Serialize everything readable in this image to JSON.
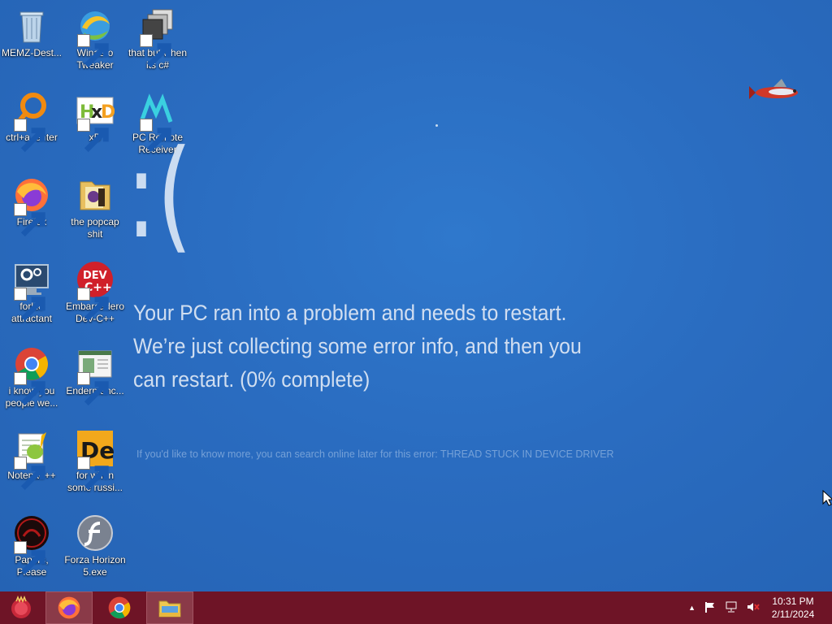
{
  "desktop_icons": [
    {
      "label": "MEMZ-Dest...",
      "icon": "recycle-bin-icon"
    },
    {
      "label": "Winaero Tweaker",
      "icon": "winaero-tweaker-icon"
    },
    {
      "label": "that but when its c#",
      "icon": "stacked-windows-icon"
    },
    {
      "label": "ctrl+a, enter",
      "icon": "orange-ring-icon"
    },
    {
      "label": "xD",
      "icon": "hxd-icon"
    },
    {
      "label": "PC Remote Receiver",
      "icon": "pc-remote-icon"
    },
    {
      "label": "Firefox",
      "icon": "firefox-icon"
    },
    {
      "label": "the popcap shit",
      "icon": "folder-icon"
    },
    {
      "label": "forkie attractant",
      "icon": "computer-settings-icon"
    },
    {
      "label": "Embarcadero Dev-C++",
      "icon": "devcpp-icon"
    },
    {
      "label": "i know you people we...",
      "icon": "chrome-icon"
    },
    {
      "label": "Endermanc...",
      "icon": "window-app-icon"
    },
    {
      "label": "Notepad++",
      "icon": "notepadpp-icon"
    },
    {
      "label": "for when some russi...",
      "icon": "de-icon"
    },
    {
      "label": "Papers, Please",
      "icon": "papers-please-icon"
    },
    {
      "label": "Forza Horizon 5.exe",
      "icon": "flash-icon"
    }
  ],
  "bsod": {
    "face": ":(",
    "message": "Your PC ran into a problem and needs to restart. We’re just collecting some error info, and then you can restart. (0% complete)",
    "info": "If you'd like to know more, you can search online later for this error: THREAD STUCK IN DEVICE DRIVER"
  },
  "taskbar": {
    "start_icon": "start-orb-icon",
    "pinned": [
      {
        "name": "firefox",
        "icon": "firefox-icon",
        "active": true
      },
      {
        "name": "chrome",
        "icon": "chrome-icon",
        "active": false
      },
      {
        "name": "file-explorer",
        "icon": "file-explorer-icon",
        "active": true
      }
    ],
    "tray": {
      "show_hidden_glyph": "▲",
      "icons": [
        "action-center-flag-icon",
        "network-icon",
        "volume-muted-icon"
      ]
    },
    "clock": {
      "time": "10:31 PM",
      "date": "2/11/2024"
    }
  },
  "colors": {
    "desktop_blue": "#2a6cc0",
    "taskbar": "#6e1426"
  }
}
